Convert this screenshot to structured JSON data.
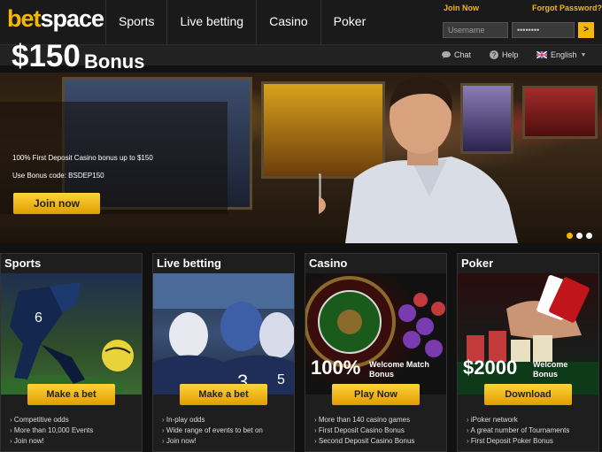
{
  "header": {
    "logo_bet": "bet",
    "logo_space": "space",
    "nav": [
      "Sports",
      "Live betting",
      "Casino",
      "Poker"
    ],
    "join_now": "Join Now",
    "forgot_password": "Forgot Password?",
    "username_placeholder": "Username",
    "password_value": "••••••••",
    "go_label": ">"
  },
  "subbar": {
    "chat": "Chat",
    "help": "Help",
    "language": "English"
  },
  "hero": {
    "amount": "$150",
    "bonus": "Bonus",
    "description": "100% First Deposit Casino bonus up to $150",
    "code": "Use Bonus code: BSDEP150",
    "cta": "Join now",
    "slides": 3,
    "active_slide": 1
  },
  "panels": [
    {
      "title": "Sports",
      "button": "Make a bet",
      "items": [
        "Competitive odds",
        "More than 10,000 Events",
        "Join now!"
      ]
    },
    {
      "title": "Live betting",
      "button": "Make a bet",
      "items": [
        "In-play odds",
        "Wide range of events to bet on",
        "Join now!"
      ]
    },
    {
      "title": "Casino",
      "button": "Play Now",
      "overlay_big": "100%",
      "overlay_small_1": "Welcome Match",
      "overlay_small_2": "Bonus",
      "items": [
        "More than 140 casino games",
        "First Deposit Casino Bonus",
        "Second Deposit Casino Bonus"
      ]
    },
    {
      "title": "Poker",
      "button": "Download",
      "overlay_big": "$2000",
      "overlay_small_1": "Welcome",
      "overlay_small_2": "Bonus",
      "items": [
        "iPoker network",
        "A great number of Tournaments",
        "First Deposit Poker Bonus"
      ]
    }
  ],
  "colors": {
    "accent": "#f5b800",
    "background": "#111111",
    "header": "#1a1a1a"
  }
}
